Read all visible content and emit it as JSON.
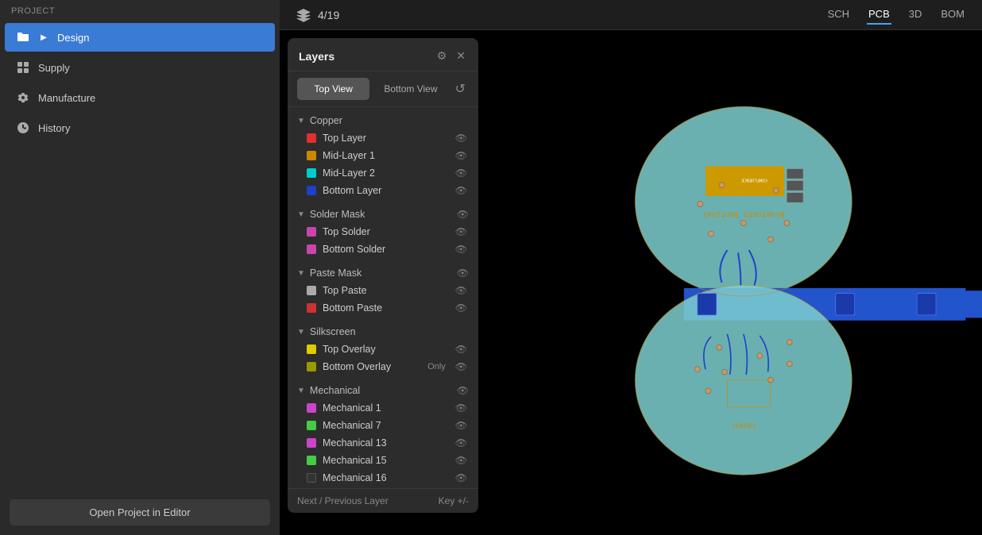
{
  "sidebar": {
    "header": "PROJECT",
    "items": [
      {
        "id": "design",
        "label": "Design",
        "icon": "folder",
        "active": true,
        "hasChevron": true
      },
      {
        "id": "supply",
        "label": "Supply",
        "icon": "grid",
        "active": false
      },
      {
        "id": "manufacture",
        "label": "Manufacture",
        "icon": "settings",
        "active": false
      },
      {
        "id": "history",
        "label": "History",
        "icon": "clock",
        "active": false
      }
    ],
    "open_editor_label": "Open Project in Editor"
  },
  "topbar": {
    "page_indicator": "4/19",
    "nav_tabs": [
      {
        "id": "sch",
        "label": "SCH",
        "active": false
      },
      {
        "id": "pcb",
        "label": "PCB",
        "active": true
      },
      {
        "id": "3d",
        "label": "3D",
        "active": false
      },
      {
        "id": "bom",
        "label": "BOM",
        "active": false
      }
    ]
  },
  "layers_panel": {
    "title": "Layers",
    "view_top_label": "Top View",
    "view_bottom_label": "Bottom View",
    "active_view": "top",
    "groups": [
      {
        "id": "copper",
        "name": "Copper",
        "expanded": true,
        "layers": [
          {
            "name": "Top Layer",
            "color": "#e03030",
            "visible": true
          },
          {
            "name": "Mid-Layer 1",
            "color": "#cc8800",
            "visible": true
          },
          {
            "name": "Mid-Layer 2",
            "color": "#00cccc",
            "visible": true
          },
          {
            "name": "Bottom Layer",
            "color": "#1e40cc",
            "visible": true
          }
        ]
      },
      {
        "id": "solder-mask",
        "name": "Solder Mask",
        "expanded": true,
        "layers": [
          {
            "name": "Top Solder",
            "color": "#cc44aa",
            "visible": true
          },
          {
            "name": "Bottom Solder",
            "color": "#cc44aa",
            "visible": true
          }
        ]
      },
      {
        "id": "paste-mask",
        "name": "Paste Mask",
        "expanded": true,
        "layers": [
          {
            "name": "Top Paste",
            "color": "#aaaaaa",
            "visible": true
          },
          {
            "name": "Bottom Paste",
            "color": "#cc3333",
            "visible": true
          }
        ]
      },
      {
        "id": "silkscreen",
        "name": "Silkscreen",
        "expanded": true,
        "layers": [
          {
            "name": "Top Overlay",
            "color": "#ddcc00",
            "visible": true
          },
          {
            "name": "Bottom Overlay",
            "color": "#999900",
            "visible": true,
            "only": true
          }
        ]
      },
      {
        "id": "mechanical",
        "name": "Mechanical",
        "expanded": true,
        "layers": [
          {
            "name": "Mechanical 1",
            "color": "#cc44cc",
            "visible": true
          },
          {
            "name": "Mechanical 7",
            "color": "#44cc44",
            "visible": true
          },
          {
            "name": "Mechanical 13",
            "color": "#cc44cc",
            "visible": true
          },
          {
            "name": "Mechanical 15",
            "color": "#44cc44",
            "visible": true
          },
          {
            "name": "Mechanical 16",
            "color": "#222222",
            "visible": true
          }
        ]
      }
    ],
    "footer": {
      "label": "Next / Previous Layer",
      "key": "Key +/-"
    }
  }
}
